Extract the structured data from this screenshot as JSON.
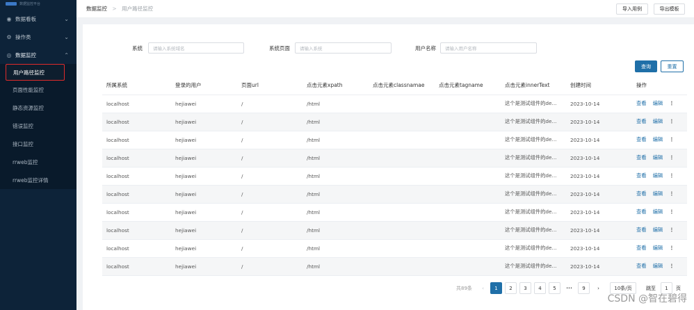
{
  "sidebar": {
    "logo_text": "数据监控平台",
    "items": [
      {
        "label": "数据看板",
        "icon": "dashboard-icon"
      },
      {
        "label": "操作类",
        "icon": "settings-icon"
      },
      {
        "label": "数据监控",
        "icon": "monitor-icon"
      }
    ],
    "subitems": [
      "用户路径监控",
      "页面性能监控",
      "静态资源监控",
      "错误监控",
      "接口监控",
      "rrweb监控",
      "rrweb监控详情"
    ]
  },
  "header": {
    "breadcrumb_root": "数据监控",
    "breadcrumb_sep": ">",
    "breadcrumb_current": "用户路径监控",
    "import_label": "导入用例",
    "export_label": "导出模板"
  },
  "filter": {
    "system_label": "系统",
    "system_placeholder": "请输入系统域名",
    "page_label": "系统页面",
    "page_placeholder": "请输入系统",
    "user_label": "用户名称",
    "user_placeholder": "请输入用户名称",
    "query_label": "查询",
    "reset_label": "重置"
  },
  "table": {
    "columns": [
      "所属系统",
      "登录的用户",
      "页面url",
      "点击元素xpath",
      "点击元素classnamae",
      "点击元素tagname",
      "点击元素innerText",
      "创建时间",
      "操作"
    ],
    "view_label": "查看",
    "edit_label": "编辑",
    "more_label": "⋮",
    "rows": [
      [
        "localhost",
        "hejiawei",
        "/",
        "/html",
        "",
        "",
        "这个是测试组件的de...",
        "2023-10-14"
      ],
      [
        "localhost",
        "hejiawei",
        "/",
        "/html",
        "",
        "",
        "这个是测试组件的de...",
        "2023-10-14"
      ],
      [
        "localhost",
        "hejiawei",
        "/",
        "/html",
        "",
        "",
        "这个是测试组件的de...",
        "2023-10-14"
      ],
      [
        "localhost",
        "hejiawei",
        "/",
        "/html",
        "",
        "",
        "这个是测试组件的de...",
        "2023-10-14"
      ],
      [
        "localhost",
        "hejiawei",
        "/",
        "/html",
        "",
        "",
        "这个是测试组件的de...",
        "2023-10-14"
      ],
      [
        "localhost",
        "hejiawei",
        "/",
        "/html",
        "",
        "",
        "这个是测试组件的de...",
        "2023-10-14"
      ],
      [
        "localhost",
        "hejiawei",
        "/",
        "/html",
        "",
        "",
        "这个是测试组件的de...",
        "2023-10-14"
      ],
      [
        "localhost",
        "hejiawei",
        "/",
        "/html",
        "",
        "",
        "这个是测试组件的de...",
        "2023-10-14"
      ],
      [
        "localhost",
        "hejiawei",
        "/",
        "/html",
        "",
        "",
        "这个是测试组件的de...",
        "2023-10-14"
      ],
      [
        "localhost",
        "hejiawei",
        "/",
        "/html",
        "",
        "",
        "这个是测试组件的de...",
        "2023-10-14"
      ]
    ]
  },
  "pagination": {
    "total": "共89条",
    "prev": "‹",
    "pages": [
      "1",
      "2",
      "3",
      "4",
      "5"
    ],
    "ellipsis": "•••",
    "last": "9",
    "next": "›",
    "page_size": "10条/页",
    "goto_label": "跳至",
    "goto_value": "1",
    "page_suffix": "页"
  },
  "watermark": "CSDN @智在碧得",
  "colors": {
    "sidebar_bg": "#0d2339",
    "primary": "#1f6fa8",
    "highlight_border": "#e02b2b"
  }
}
